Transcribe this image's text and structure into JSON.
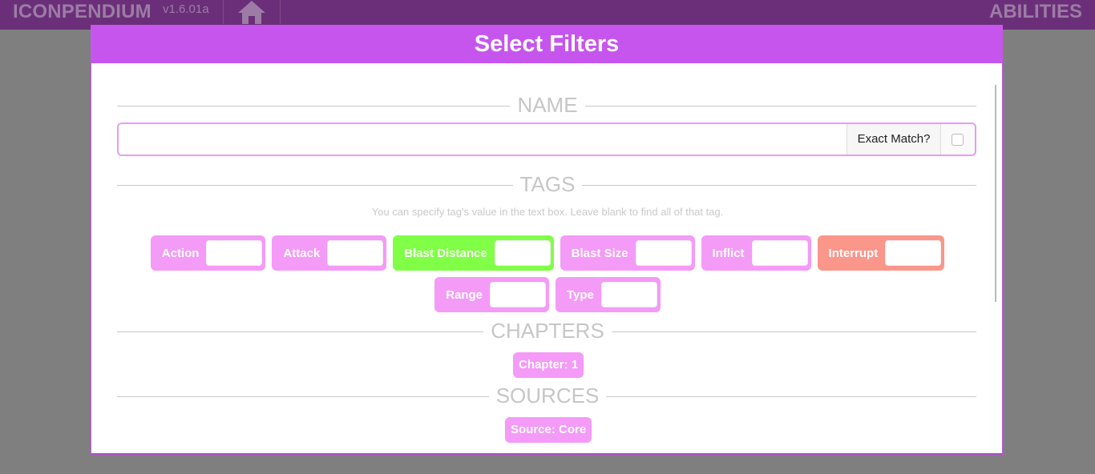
{
  "app": {
    "brand": "ICONPENDIUM",
    "version": "v1.6.01a",
    "section": "ABILITIES",
    "home_icon": "home-icon"
  },
  "modal": {
    "title": "Select Filters",
    "accent_color": "#c655ed"
  },
  "name_section": {
    "heading": "NAME",
    "input_value": "",
    "exact_match_label": "Exact Match?",
    "exact_match_checked": false
  },
  "tags_section": {
    "heading": "TAGS",
    "hint": "You can specify tag's value in the text box. Leave blank to find all of that tag.",
    "tags": [
      {
        "label": "Action",
        "value": "",
        "color": "#f49af7"
      },
      {
        "label": "Attack",
        "value": "",
        "color": "#f49af7"
      },
      {
        "label": "Blast Distance",
        "value": "",
        "color": "#80ff46"
      },
      {
        "label": "Blast Size",
        "value": "",
        "color": "#f49af7"
      },
      {
        "label": "Inflict",
        "value": "",
        "color": "#f49af7"
      },
      {
        "label": "Interrupt",
        "value": "",
        "color": "#fa968a"
      },
      {
        "label": "Range",
        "value": "",
        "color": "#f49af7"
      },
      {
        "label": "Type",
        "value": "",
        "color": "#f49af7"
      }
    ]
  },
  "chapters_section": {
    "heading": "CHAPTERS",
    "items": [
      "Chapter: 1"
    ]
  },
  "sources_section": {
    "heading": "SOURCES",
    "items": [
      "Source: Core"
    ]
  }
}
